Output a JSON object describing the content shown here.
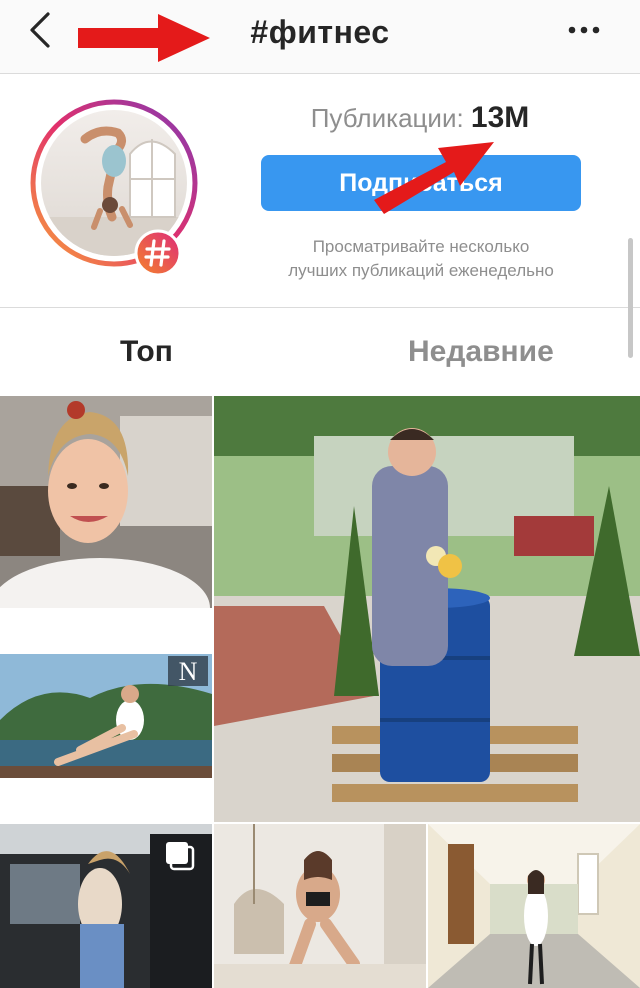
{
  "header": {
    "title": "#фитнес",
    "back_icon": "chevron-left-icon",
    "more_icon": "more-horizontal-icon"
  },
  "profile": {
    "publications_label": "Публикации:",
    "publications_count": "13M",
    "follow_label": "Подписаться",
    "hint_line1": "Просматривайте несколько",
    "hint_line2": "лучших публикаций еженедельно",
    "badge_icon": "hashtag-icon"
  },
  "tabs": [
    {
      "label": "Топ",
      "active": true
    },
    {
      "label": "Недавние",
      "active": false
    }
  ],
  "grid": {
    "posts": [
      {
        "subject": "woman-selfie-home"
      },
      {
        "subject": "man-with-blue-barrel"
      },
      {
        "subject": "woman-sitting-lake-mountains"
      },
      {
        "subject": "woman-by-car",
        "multi_photo": true
      },
      {
        "subject": "woman-swing-room"
      },
      {
        "subject": "woman-hallway"
      }
    ],
    "watermark_letter": "N"
  },
  "colors": {
    "accent_blue": "#3897f0",
    "annotation_red": "#e41a1a",
    "ring_gradient": [
      "#f9a23a",
      "#e1306c",
      "#833ab4"
    ]
  }
}
